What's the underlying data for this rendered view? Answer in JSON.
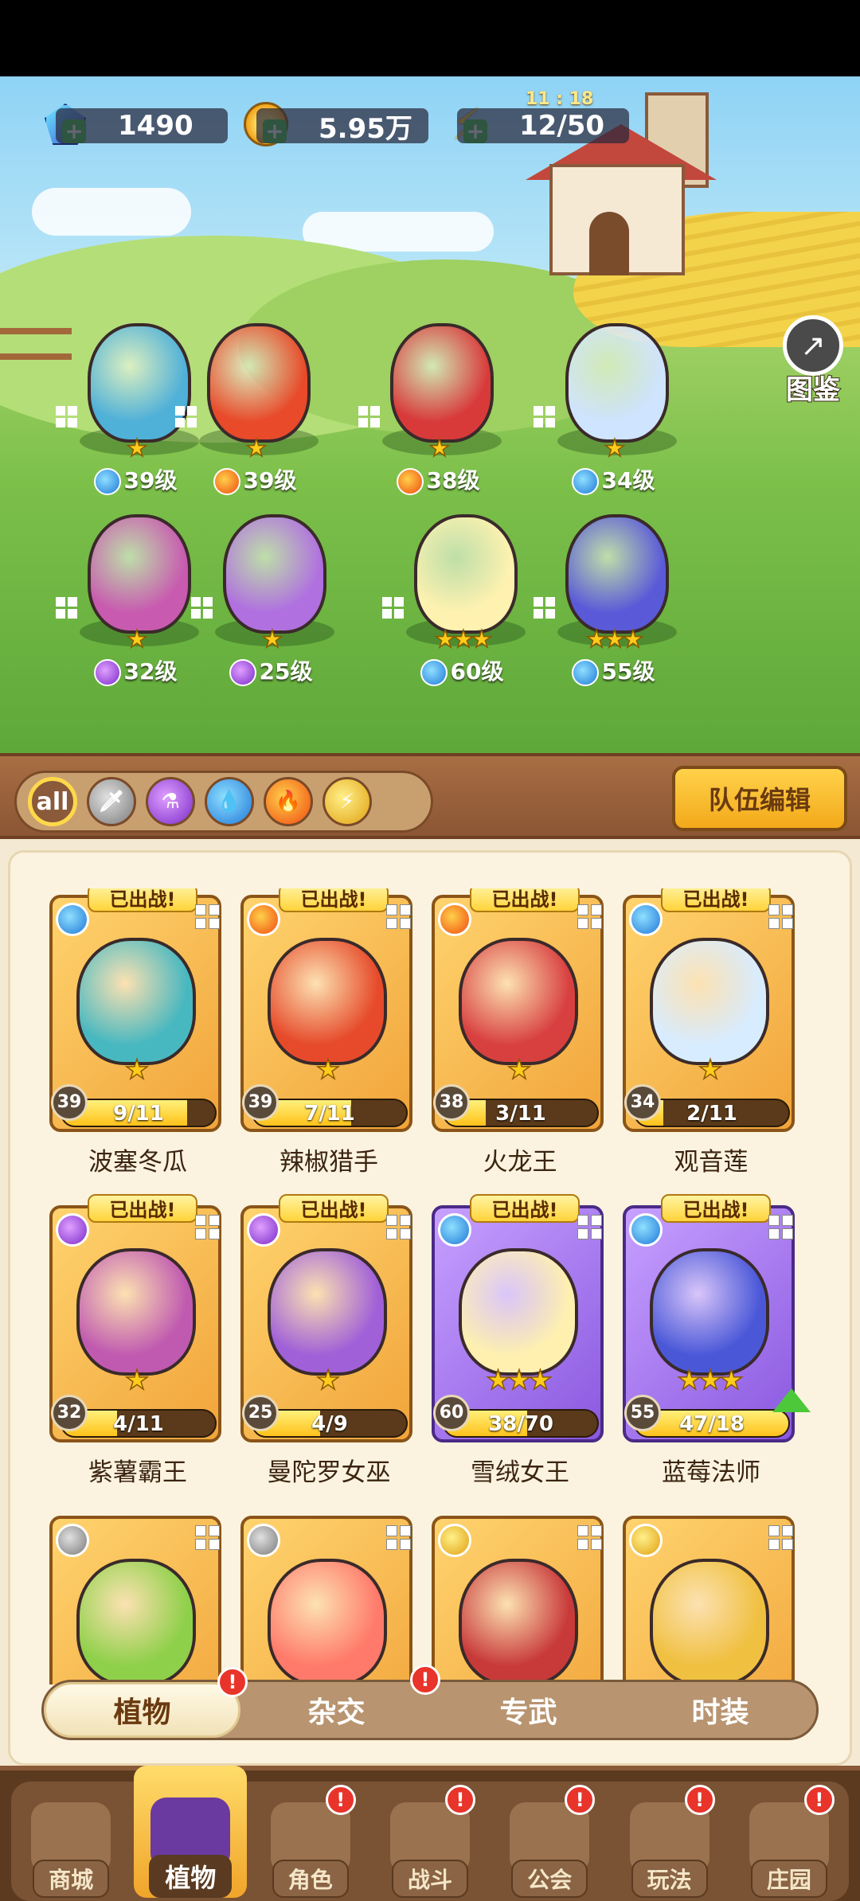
{
  "resources": {
    "gems": "1490",
    "gold": "5.95万",
    "energy": "12/50",
    "energy_timer": "11 : 18"
  },
  "encyclopedia_label": "图鉴",
  "lineup": [
    {
      "element": "water",
      "stars": "★",
      "level": "39级"
    },
    {
      "element": "fire",
      "stars": "★",
      "level": "39级"
    },
    {
      "element": "fire",
      "stars": "★",
      "level": "38级"
    },
    {
      "element": "water",
      "stars": "★",
      "level": "34级"
    },
    {
      "element": "poison",
      "stars": "★",
      "level": "32级"
    },
    {
      "element": "poison",
      "stars": "★",
      "level": "25级"
    },
    {
      "element": "water",
      "stars": "★★★",
      "level": "60级"
    },
    {
      "element": "water",
      "stars": "★★★",
      "level": "55级"
    }
  ],
  "filters": {
    "all": "all",
    "team_edit": "队伍编辑"
  },
  "cards": [
    {
      "tag": "已出战!",
      "level": "39",
      "progress": "9/11",
      "fill": 0.82,
      "name": "波塞冬瓜",
      "stars": "★",
      "element": "water",
      "purple": false
    },
    {
      "tag": "已出战!",
      "level": "39",
      "progress": "7/11",
      "fill": 0.64,
      "name": "辣椒猎手",
      "stars": "★",
      "element": "fire",
      "purple": false
    },
    {
      "tag": "已出战!",
      "level": "38",
      "progress": "3/11",
      "fill": 0.27,
      "name": "火龙王",
      "stars": "★",
      "element": "fire",
      "purple": false
    },
    {
      "tag": "已出战!",
      "level": "34",
      "progress": "2/11",
      "fill": 0.18,
      "name": "观音莲",
      "stars": "★",
      "element": "water",
      "purple": false
    },
    {
      "tag": "已出战!",
      "level": "32",
      "progress": "4/11",
      "fill": 0.36,
      "name": "紫薯霸王",
      "stars": "★",
      "element": "poison",
      "purple": false
    },
    {
      "tag": "已出战!",
      "level": "25",
      "progress": "4/9",
      "fill": 0.44,
      "name": "曼陀罗女巫",
      "stars": "★",
      "element": "poison",
      "purple": false
    },
    {
      "tag": "已出战!",
      "level": "60",
      "progress": "38/70",
      "fill": 0.54,
      "name": "雪绒女王",
      "stars": "★★★",
      "element": "water",
      "purple": true
    },
    {
      "tag": "已出战!",
      "level": "55",
      "progress": "47/18",
      "fill": 1.0,
      "name": "蓝莓法师",
      "stars": "★★★",
      "element": "water",
      "purple": true
    }
  ],
  "partial_cards": [
    "sword",
    "sword",
    "thunder",
    "thunder"
  ],
  "subtabs": [
    "植物",
    "杂交",
    "专武",
    "时装"
  ],
  "nav": [
    "商城",
    "植物",
    "角色",
    "战斗",
    "公会",
    "玩法",
    "庄园"
  ],
  "badge": "!"
}
